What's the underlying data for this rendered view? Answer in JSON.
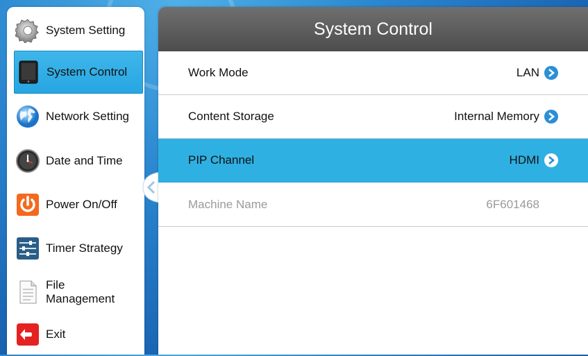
{
  "sidebar": {
    "items": [
      {
        "label": "System Setting",
        "icon": "gear-icon"
      },
      {
        "label": "System Control",
        "icon": "tablet-icon"
      },
      {
        "label": "Network Setting",
        "icon": "globe-icon"
      },
      {
        "label": "Date and Time",
        "icon": "clock-icon"
      },
      {
        "label": "Power On/Off",
        "icon": "power-icon"
      },
      {
        "label": "Timer Strategy",
        "icon": "sliders-icon"
      },
      {
        "label": "File Management",
        "icon": "document-icon"
      },
      {
        "label": "Exit",
        "icon": "exit-icon"
      }
    ],
    "active_index": 1
  },
  "main": {
    "title": "System Control",
    "rows": [
      {
        "label": "Work Mode",
        "value": "LAN",
        "state": "normal"
      },
      {
        "label": "Content Storage",
        "value": "Internal Memory",
        "state": "normal"
      },
      {
        "label": "PIP Channel",
        "value": "HDMI",
        "state": "selected"
      },
      {
        "label": "Machine Name",
        "value": "6F601468",
        "state": "disabled"
      }
    ]
  },
  "colors": {
    "accent": "#2fb0e2",
    "header": "#5a5a5a",
    "background": "#2a86cf"
  }
}
